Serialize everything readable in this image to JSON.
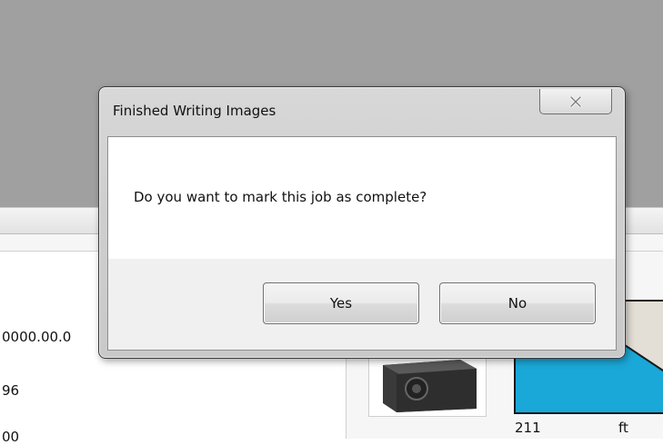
{
  "dialog": {
    "title": "Finished Writing Images",
    "message": "Do you want to mark this job as complete?",
    "yes_label": "Yes",
    "no_label": "No",
    "close_icon": "close-icon"
  },
  "background": {
    "row_value_1": "0000.00.0",
    "row_value_2": "96",
    "row_value_3": "00",
    "fuel_value": "211",
    "fuel_unit": "ft"
  },
  "colors": {
    "tank_fill": "#1aa8d8",
    "tank_outline": "#1a1a1a",
    "background_gray": "#a0a0a0"
  }
}
